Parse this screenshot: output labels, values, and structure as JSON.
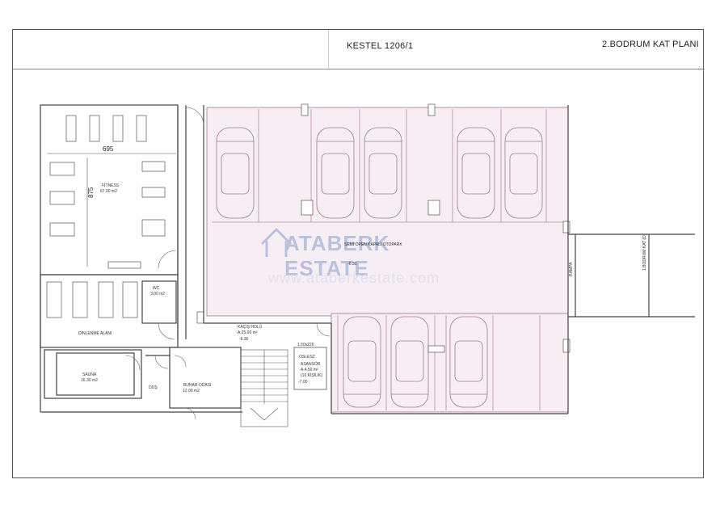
{
  "header": {
    "project": "KESTEL 1206/1",
    "plan_title": "2.BODRUM KAT PLANI"
  },
  "rooms": {
    "fitness": {
      "name": "FITNESS",
      "area": "67.00 m2"
    },
    "wc": {
      "name": "WC",
      "area": "3.00 m2"
    },
    "lounge": {
      "name": "DİNLENME ALANI"
    },
    "sauna": {
      "name": "SAUNA",
      "area": "16.30 m2"
    },
    "shower": {
      "name": "DUŞ"
    },
    "steam": {
      "name": "BUHAR ODASI",
      "area": "12.00 m2"
    },
    "escape": {
      "name": "KAÇIŞ HOLÜ",
      "area": "A:25.00 m²",
      "level": "-6.30"
    },
    "elevator_void": {
      "name": "OSLESZ",
      "line2": "ASANSÖR",
      "line3": "A:4.50 m²",
      "line4": "(10 KİŞİLİK)",
      "level": "-7.00"
    },
    "parking": {
      "name": "SEMİ OPEN KAPALI OTOPARK",
      "level": "-6.30"
    }
  },
  "dimensions": {
    "width": "695",
    "height": "875"
  },
  "annotations": {
    "ramp": "RAMPA",
    "boundary": "1.BODRUM KAT (D)",
    "door_tag": "1.50x220"
  },
  "watermark": {
    "brand": "ATABERK ESTATE",
    "url": "www.ataberkestate.com"
  },
  "colors": {
    "parking_fill": "#f7eef3",
    "parking_line": "#b98aa7",
    "wall": "#444444",
    "watermark": "#4a6fb5"
  }
}
